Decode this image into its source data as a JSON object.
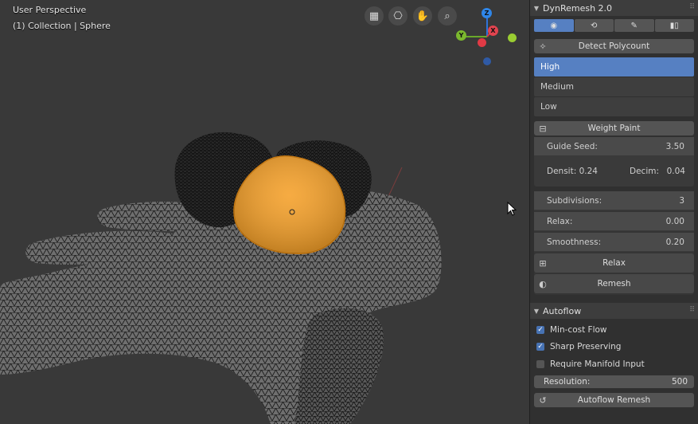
{
  "viewport": {
    "title": "User Perspective",
    "subtitle": "(1) Collection | Sphere",
    "nav_icons": [
      "grid-view-icon",
      "camera-icon",
      "hand-pan-icon",
      "zoom-icon"
    ],
    "gizmo": {
      "z": "Z",
      "y": "Y",
      "x": "X"
    },
    "colors": {
      "mesh_selected": "#f5a12b",
      "background": "#393939"
    }
  },
  "panel": {
    "title": "DynRemesh 2.0",
    "tabs": [
      {
        "icon": "eye-icon",
        "glyph": "◉"
      },
      {
        "icon": "refresh-icon",
        "glyph": "⟲"
      },
      {
        "icon": "brush-icon",
        "glyph": "✎"
      },
      {
        "icon": "split-icon",
        "glyph": "▮▯"
      }
    ],
    "detect_button": "Detect Polycount",
    "polycount": [
      "High",
      "Medium",
      "Low"
    ],
    "weight_paint_button": "Weight Paint",
    "guide_seed": {
      "label": "Guide Seed:",
      "value": "3.50"
    },
    "densit": {
      "label": "Densit:",
      "value": "0.24"
    },
    "decim": {
      "label": "Decim:",
      "value": "0.04"
    },
    "subdivisions": {
      "label": "Subdivisions:",
      "value": "3"
    },
    "relax_field": {
      "label": "Relax:",
      "value": "0.00"
    },
    "smoothness": {
      "label": "Smoothness:",
      "value": "0.20"
    },
    "relax_button": "Relax",
    "remesh_button": "Remesh"
  },
  "autoflow": {
    "title": "Autoflow",
    "options": [
      {
        "label": "Min-cost Flow",
        "checked": true
      },
      {
        "label": "Sharp Preserving",
        "checked": true
      },
      {
        "label": "Require Manifold Input",
        "checked": false
      }
    ],
    "resolution": {
      "label": "Resolution:",
      "value": "500"
    },
    "remesh_button": "Autoflow Remesh"
  }
}
